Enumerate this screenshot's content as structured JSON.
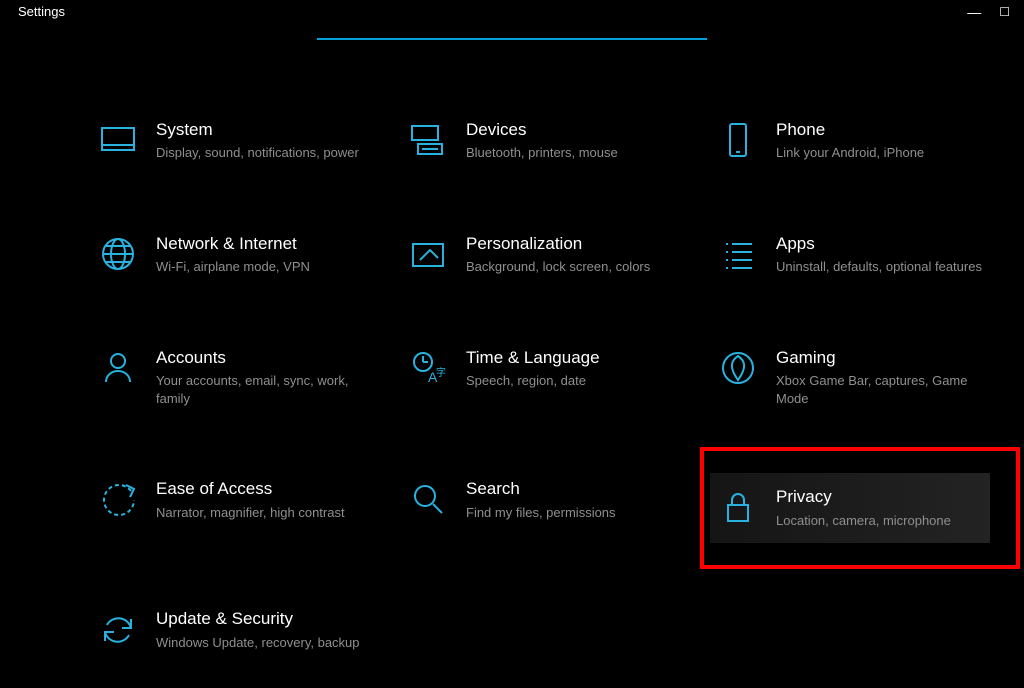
{
  "window": {
    "title": "Settings"
  },
  "tiles": [
    {
      "id": "system",
      "name": "System",
      "desc": "Display, sound, notifications, power"
    },
    {
      "id": "devices",
      "name": "Devices",
      "desc": "Bluetooth, printers, mouse"
    },
    {
      "id": "phone",
      "name": "Phone",
      "desc": "Link your Android, iPhone"
    },
    {
      "id": "network",
      "name": "Network & Internet",
      "desc": "Wi-Fi, airplane mode, VPN"
    },
    {
      "id": "personalization",
      "name": "Personalization",
      "desc": "Background, lock screen, colors"
    },
    {
      "id": "apps",
      "name": "Apps",
      "desc": "Uninstall, defaults, optional features"
    },
    {
      "id": "accounts",
      "name": "Accounts",
      "desc": "Your accounts, email, sync, work, family"
    },
    {
      "id": "time",
      "name": "Time & Language",
      "desc": "Speech, region, date"
    },
    {
      "id": "gaming",
      "name": "Gaming",
      "desc": "Xbox Game Bar, captures, Game Mode"
    },
    {
      "id": "ease",
      "name": "Ease of Access",
      "desc": "Narrator, magnifier, high contrast"
    },
    {
      "id": "search",
      "name": "Search",
      "desc": "Find my files, permissions"
    },
    {
      "id": "privacy",
      "name": "Privacy",
      "desc": "Location, camera, microphone"
    },
    {
      "id": "update",
      "name": "Update & Security",
      "desc": "Windows Update, recovery, backup"
    }
  ],
  "highlighted_tile": "privacy",
  "colors": {
    "accent": "#29b2df",
    "highlight_border": "#ff0000"
  }
}
